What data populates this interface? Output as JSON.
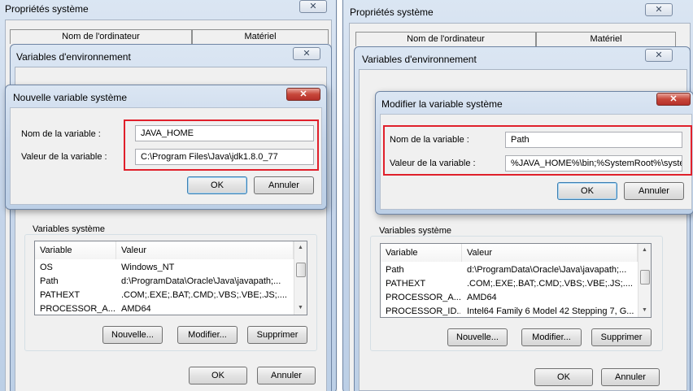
{
  "left": {
    "system_props_title": "Propriétés système",
    "tabs": {
      "computer_name": "Nom de l'ordinateur",
      "hardware": "Matériel"
    },
    "env_title": "Variables d'environnement",
    "dialog": {
      "title": "Nouvelle variable système",
      "name_label": "Nom de la variable :",
      "name_value": "JAVA_HOME",
      "value_label": "Valeur de la variable :",
      "value_value": "C:\\Program Files\\Java\\jdk1.8.0_77",
      "ok": "OK",
      "cancel": "Annuler"
    },
    "sysvars": {
      "group_label": "Variables système",
      "col_variable": "Variable",
      "col_value": "Valeur",
      "rows": [
        {
          "name": "OS",
          "value": "Windows_NT"
        },
        {
          "name": "Path",
          "value": "d:\\ProgramData\\Oracle\\Java\\javapath;..."
        },
        {
          "name": "PATHEXT",
          "value": ".COM;.EXE;.BAT;.CMD;.VBS;.VBE;.JS;...."
        },
        {
          "name": "PROCESSOR_A...",
          "value": "AMD64"
        }
      ],
      "new": "Nouvelle...",
      "edit": "Modifier...",
      "delete": "Supprimer"
    },
    "bottom_ok": "OK",
    "bottom_cancel": "Annuler"
  },
  "right": {
    "system_props_title": "Propriétés système",
    "tabs": {
      "computer_name": "Nom de l'ordinateur",
      "hardware": "Matériel"
    },
    "env_title": "Variables d'environnement",
    "dialog": {
      "title": "Modifier la variable système",
      "name_label": "Nom de la variable :",
      "name_value": "Path",
      "value_label": "Valeur de la variable :",
      "value_value": "%JAVA_HOME%\\bin;%SystemRoot%\\syste",
      "ok": "OK",
      "cancel": "Annuler"
    },
    "sysvars": {
      "group_label": "Variables système",
      "col_variable": "Variable",
      "col_value": "Valeur",
      "rows": [
        {
          "name": "Path",
          "value": "d:\\ProgramData\\Oracle\\Java\\javapath;..."
        },
        {
          "name": "PATHEXT",
          "value": ".COM;.EXE;.BAT;.CMD;.VBS;.VBE;.JS;...."
        },
        {
          "name": "PROCESSOR_A...",
          "value": "AMD64"
        },
        {
          "name": "PROCESSOR_ID...",
          "value": "Intel64 Family 6 Model 42 Stepping 7, G..."
        }
      ],
      "new": "Nouvelle...",
      "edit": "Modifier...",
      "delete": "Supprimer"
    },
    "bottom_ok": "OK",
    "bottom_cancel": "Annuler"
  },
  "icons": {
    "close": "close-icon",
    "scroll_up": "scroll-up-arrow",
    "scroll_down": "scroll-down-arrow"
  }
}
